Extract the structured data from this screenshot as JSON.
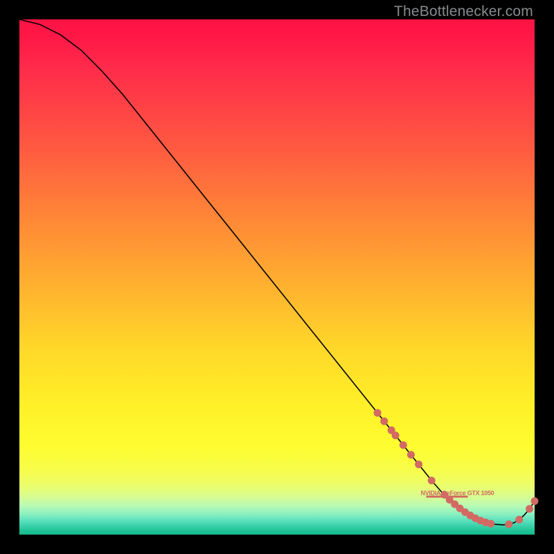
{
  "watermark": "TheBottlenecker.com",
  "colors": {
    "marker": "#d26a63",
    "curve": "#000000"
  },
  "chart_data": {
    "type": "line",
    "title": "",
    "xlabel": "",
    "ylabel": "",
    "xlim": [
      0,
      100
    ],
    "ylim": [
      0,
      100
    ],
    "grid": false,
    "legend_position": "inline",
    "series": [
      {
        "name": "NVIDIA GeForce GTX 1050",
        "x": [
          0,
          4,
          8,
          12,
          16,
          20,
          24,
          28,
          32,
          36,
          40,
          44,
          48,
          52,
          56,
          60,
          64,
          68,
          72,
          74,
          76,
          78,
          80,
          82,
          84,
          86,
          88,
          90,
          92,
          94,
          95,
          96,
          97,
          98,
          99,
          100
        ],
        "y": [
          100,
          99,
          97,
          94,
          90,
          85.5,
          80.5,
          75.5,
          70.5,
          65.5,
          60.5,
          55.5,
          50.5,
          45.5,
          40.5,
          35.5,
          30.5,
          25.5,
          20.5,
          18,
          15.5,
          13,
          10.5,
          8.2,
          6.3,
          4.7,
          3.4,
          2.5,
          2.0,
          1.9,
          2.0,
          2.3,
          2.9,
          3.8,
          5.0,
          6.5
        ]
      }
    ],
    "markers": {
      "series": 0,
      "x": [
        69.5,
        70.8,
        72.2,
        73.0,
        74.5,
        76.0,
        77.5,
        80.0,
        82.5,
        83.5,
        84.5,
        85.5,
        86.5,
        87.5,
        88.5,
        89.5,
        90.5,
        91.5,
        95.0,
        97.0,
        99.0,
        100.0
      ],
      "style": "dot",
      "radius": 5.5
    },
    "inline_label_anchor_x": 83.0
  }
}
